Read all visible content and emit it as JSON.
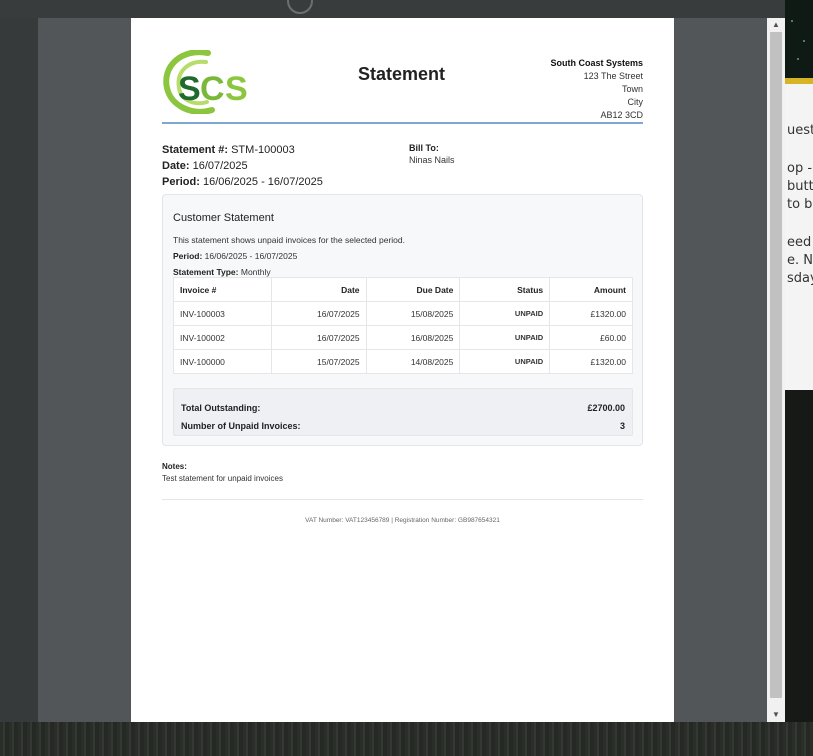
{
  "statement": {
    "title": "Statement",
    "company": {
      "name": "South Coast Systems",
      "address": [
        "123 The Street",
        "Town",
        "City",
        "AB12 3CD"
      ]
    },
    "logo_text": "SCS",
    "meta": {
      "number_label": "Statement #:",
      "number": "STM-100003",
      "date_label": "Date:",
      "date": "16/07/2025",
      "period_label": "Period:",
      "period": "16/06/2025 - 16/07/2025"
    },
    "bill_to": {
      "label": "Bill To:",
      "name": "Ninas Nails"
    },
    "card": {
      "title": "Customer Statement",
      "description": "This statement shows unpaid invoices for the selected period.",
      "period_label": "Period:",
      "period": "16/06/2025 - 16/07/2025",
      "type_label": "Statement Type:",
      "type": "Monthly"
    },
    "table": {
      "headers": [
        "Invoice #",
        "Date",
        "Due Date",
        "Status",
        "Amount"
      ],
      "rows": [
        [
          "INV-100003",
          "16/07/2025",
          "15/08/2025",
          "UNPAID",
          "£1320.00"
        ],
        [
          "INV-100002",
          "16/07/2025",
          "16/08/2025",
          "UNPAID",
          "£60.00"
        ],
        [
          "INV-100000",
          "15/07/2025",
          "14/08/2025",
          "UNPAID",
          "£1320.00"
        ]
      ]
    },
    "totals": {
      "outstanding_label": "Total Outstanding:",
      "outstanding": "£2700.00",
      "count_label": "Number of Unpaid Invoices:",
      "count": "3"
    },
    "notes": {
      "label": "Notes:",
      "text": "Test statement for unpaid invoices"
    },
    "footer": "VAT Number: VAT123456789 | Registration Number: GB987654321"
  },
  "background_text": [
    "uests",
    "op -",
    "butt",
    "to be",
    "eed t",
    "e. Ne",
    "sday."
  ],
  "colors": {
    "accent_rule": "#7ea8d3",
    "logo_green": "#8cc63f",
    "logo_dark_green": "#1f6b2e",
    "highlight_yellow": "#d6b423"
  }
}
